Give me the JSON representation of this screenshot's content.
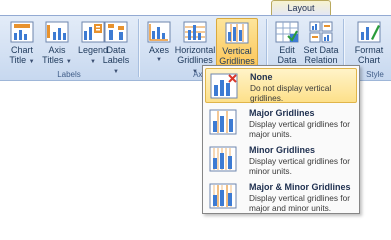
{
  "context_tab": {
    "label": "Layout"
  },
  "groups": {
    "labels": {
      "name": "Labels",
      "buttons": [
        {
          "line1": "Chart",
          "line2": "Title",
          "icon": "chart-title-icon"
        },
        {
          "line1": "Axis",
          "line2": "Titles",
          "icon": "axis-titles-icon"
        },
        {
          "line1": "Legend",
          "line2": "",
          "icon": "legend-icon"
        },
        {
          "line1": "Data",
          "line2": "Labels",
          "icon": "data-labels-icon"
        }
      ]
    },
    "axes": {
      "name": "Axes",
      "buttons": [
        {
          "line1": "Axes",
          "line2": "",
          "icon": "axes-icon"
        },
        {
          "line1": "Horizontal",
          "line2": "Gridlines",
          "icon": "horizontal-gridlines-icon"
        },
        {
          "line1": "Vertical",
          "line2": "Gridlines",
          "icon": "vertical-gridlines-icon"
        }
      ]
    },
    "data": {
      "buttons": [
        {
          "line1": "Edit",
          "line2": "Data",
          "icon": "edit-data-icon"
        },
        {
          "line1": "Set Data",
          "line2": "Relation",
          "icon": "set-data-relation-icon"
        }
      ]
    },
    "style": {
      "name": "Style",
      "name_visible": "Style",
      "buttons": [
        {
          "line1": "Format",
          "line2": "Chart",
          "icon": "format-chart-icon"
        }
      ]
    }
  },
  "dropdown": {
    "items": [
      {
        "title": "None",
        "desc": "Do not display vertical gridlines.",
        "selected": true
      },
      {
        "title": "Major Gridlines",
        "desc": "Display vertical gridlines for major units.",
        "selected": false
      },
      {
        "title": "Minor Gridlines",
        "desc": "Display vertical gridlines for minor units.",
        "selected": false
      },
      {
        "title": "Major & Minor Gridlines",
        "desc": "Display vertical gridlines for major and minor units.",
        "selected": false
      }
    ]
  },
  "colors": {
    "accent": "#fbc659",
    "ribbon": "#d4e1f3",
    "bar_blue": "#3d7bd3",
    "bar_orange": "#e8922d"
  }
}
